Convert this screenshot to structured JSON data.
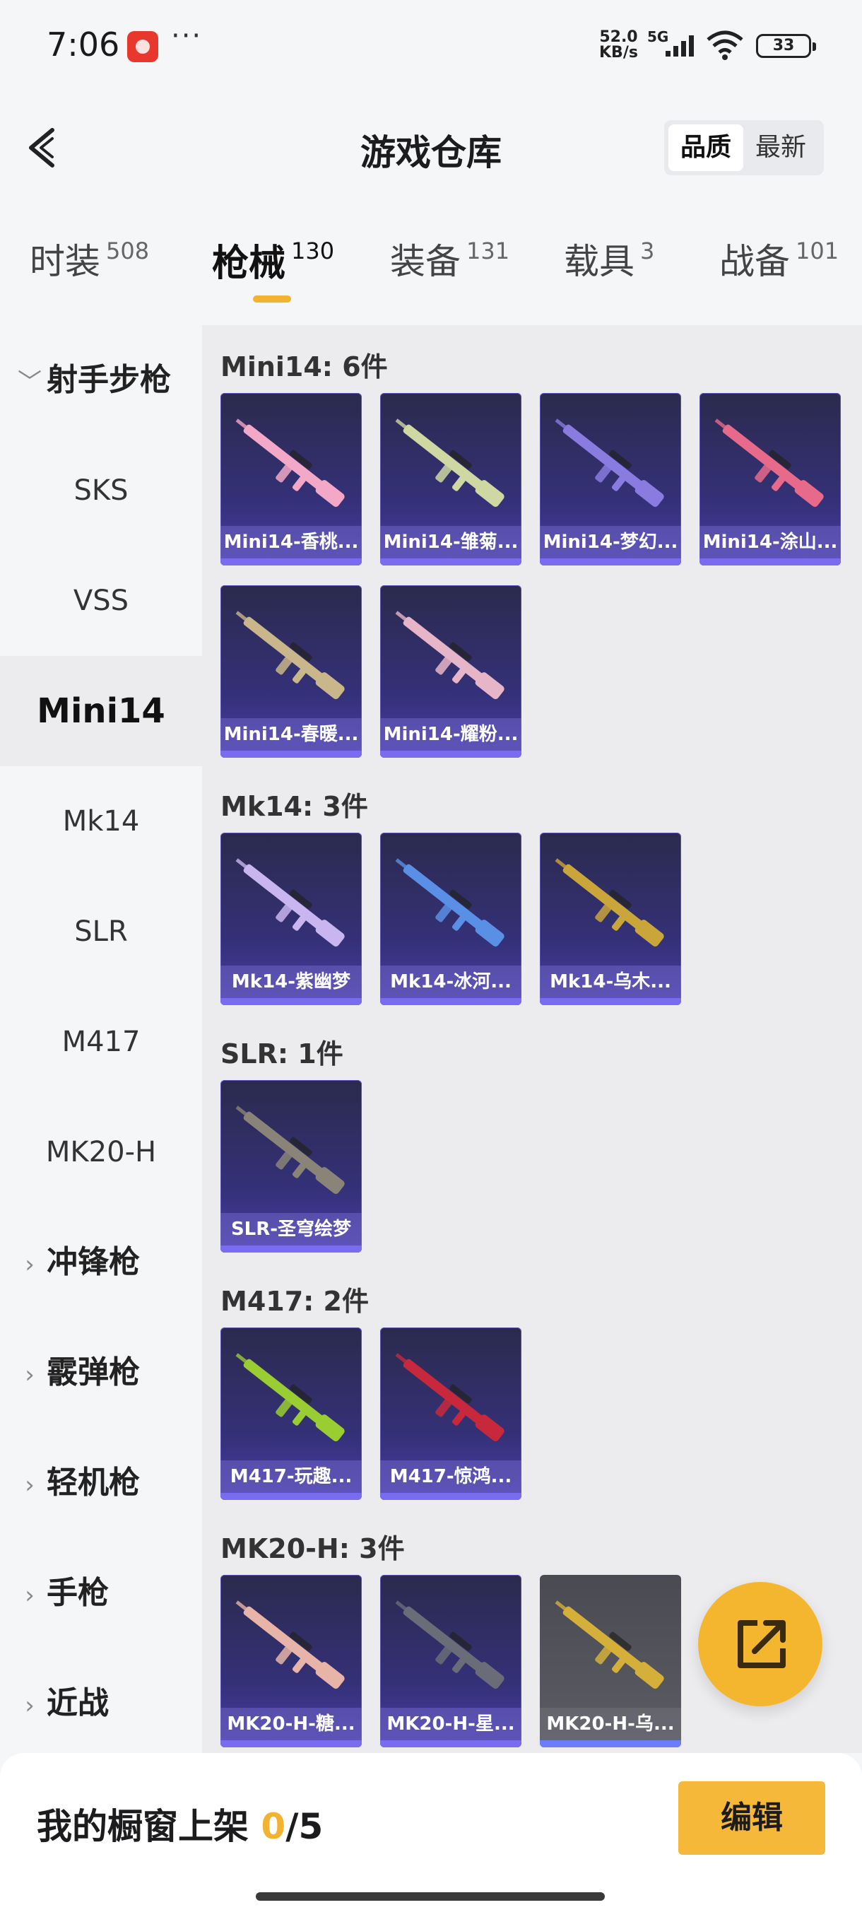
{
  "status_bar": {
    "time": "7:06",
    "more": "···",
    "net_speed_value": "52.0",
    "net_speed_unit": "KB/s",
    "network": "5G",
    "battery": "33"
  },
  "header": {
    "title": "游戏仓库",
    "sort_options": [
      "品质",
      "最新"
    ]
  },
  "tabs": [
    {
      "label": "时装",
      "count": "508"
    },
    {
      "label": "枪械",
      "count": "130"
    },
    {
      "label": "装备",
      "count": "131"
    },
    {
      "label": "载具",
      "count": "3"
    },
    {
      "label": "战备",
      "count": "101"
    }
  ],
  "sidebar": {
    "group_open": "射手步枪",
    "items": [
      "SKS",
      "VSS",
      "Mini14",
      "Mk14",
      "SLR",
      "M417",
      "MK20-H"
    ],
    "selected": "Mini14",
    "groups_closed": [
      "冲锋枪",
      "霰弹枪",
      "轻机枪",
      "手枪",
      "近战"
    ]
  },
  "sections": [
    {
      "title": "Mini14: 6件",
      "items": [
        {
          "name": "Mini14-香桃...",
          "color": "#f2a8c6"
        },
        {
          "name": "Mini14-雏菊...",
          "color": "#cfd8a2"
        },
        {
          "name": "Mini14-梦幻...",
          "color": "#8a7be0"
        },
        {
          "name": "Mini14-涂山...",
          "color": "#e86a8a"
        },
        {
          "name": "Mini14-春暖...",
          "color": "#c9b68a"
        },
        {
          "name": "Mini14-耀粉...",
          "color": "#e7b5c8"
        }
      ]
    },
    {
      "title": "Mk14: 3件",
      "items": [
        {
          "name": "Mk14-紫幽梦",
          "color": "#c9b6f0"
        },
        {
          "name": "Mk14-冰河...",
          "color": "#5a8fe6"
        },
        {
          "name": "Mk14-乌木...",
          "color": "#caa53a"
        }
      ]
    },
    {
      "title": "SLR: 1件",
      "items": [
        {
          "name": "SLR-圣穹绘梦",
          "color": "#8a8478"
        }
      ]
    },
    {
      "title": "M417: 2件",
      "items": [
        {
          "name": "M417-玩趣...",
          "color": "#9acd32"
        },
        {
          "name": "M417-惊鸿...",
          "color": "#c8283c"
        }
      ]
    },
    {
      "title": "MK20-H: 3件",
      "items": [
        {
          "name": "MK20-H-糖...",
          "color": "#e8b4a8"
        },
        {
          "name": "MK20-H-星...",
          "color": "#6a6d78"
        },
        {
          "name": "MK20-H-乌...",
          "color": "#d4b03a"
        }
      ]
    }
  ],
  "footer": {
    "label": "我的橱窗上架",
    "current": "0",
    "total": "/5",
    "edit_label": "编辑"
  }
}
